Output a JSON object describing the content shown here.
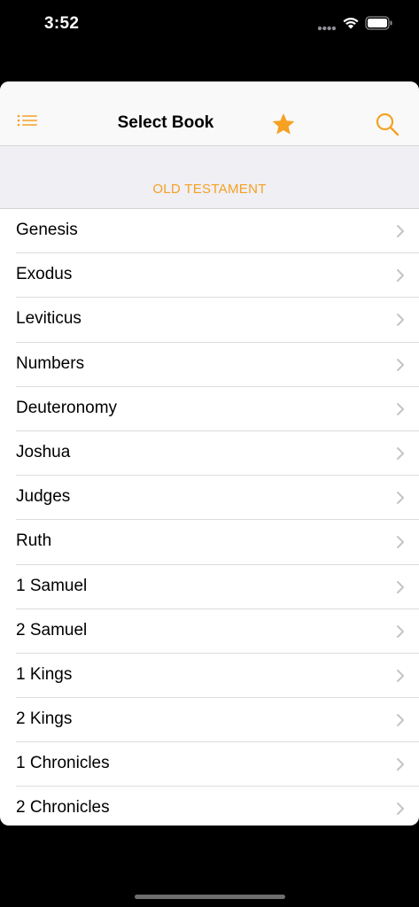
{
  "status_bar": {
    "time": "3:52"
  },
  "nav": {
    "title": "Select Book",
    "accent_color": "#f5a122",
    "icons": {
      "list": "list-icon",
      "favorite": "star-icon",
      "search": "search-icon"
    }
  },
  "section": {
    "header": "OLD TESTAMENT"
  },
  "books": [
    {
      "label": "Genesis"
    },
    {
      "label": "Exodus"
    },
    {
      "label": "Leviticus"
    },
    {
      "label": "Numbers"
    },
    {
      "label": "Deuteronomy"
    },
    {
      "label": "Joshua"
    },
    {
      "label": "Judges"
    },
    {
      "label": "Ruth"
    },
    {
      "label": "1 Samuel"
    },
    {
      "label": "2 Samuel"
    },
    {
      "label": "1 Kings"
    },
    {
      "label": "2 Kings"
    },
    {
      "label": "1 Chronicles"
    },
    {
      "label": "2 Chronicles"
    }
  ]
}
